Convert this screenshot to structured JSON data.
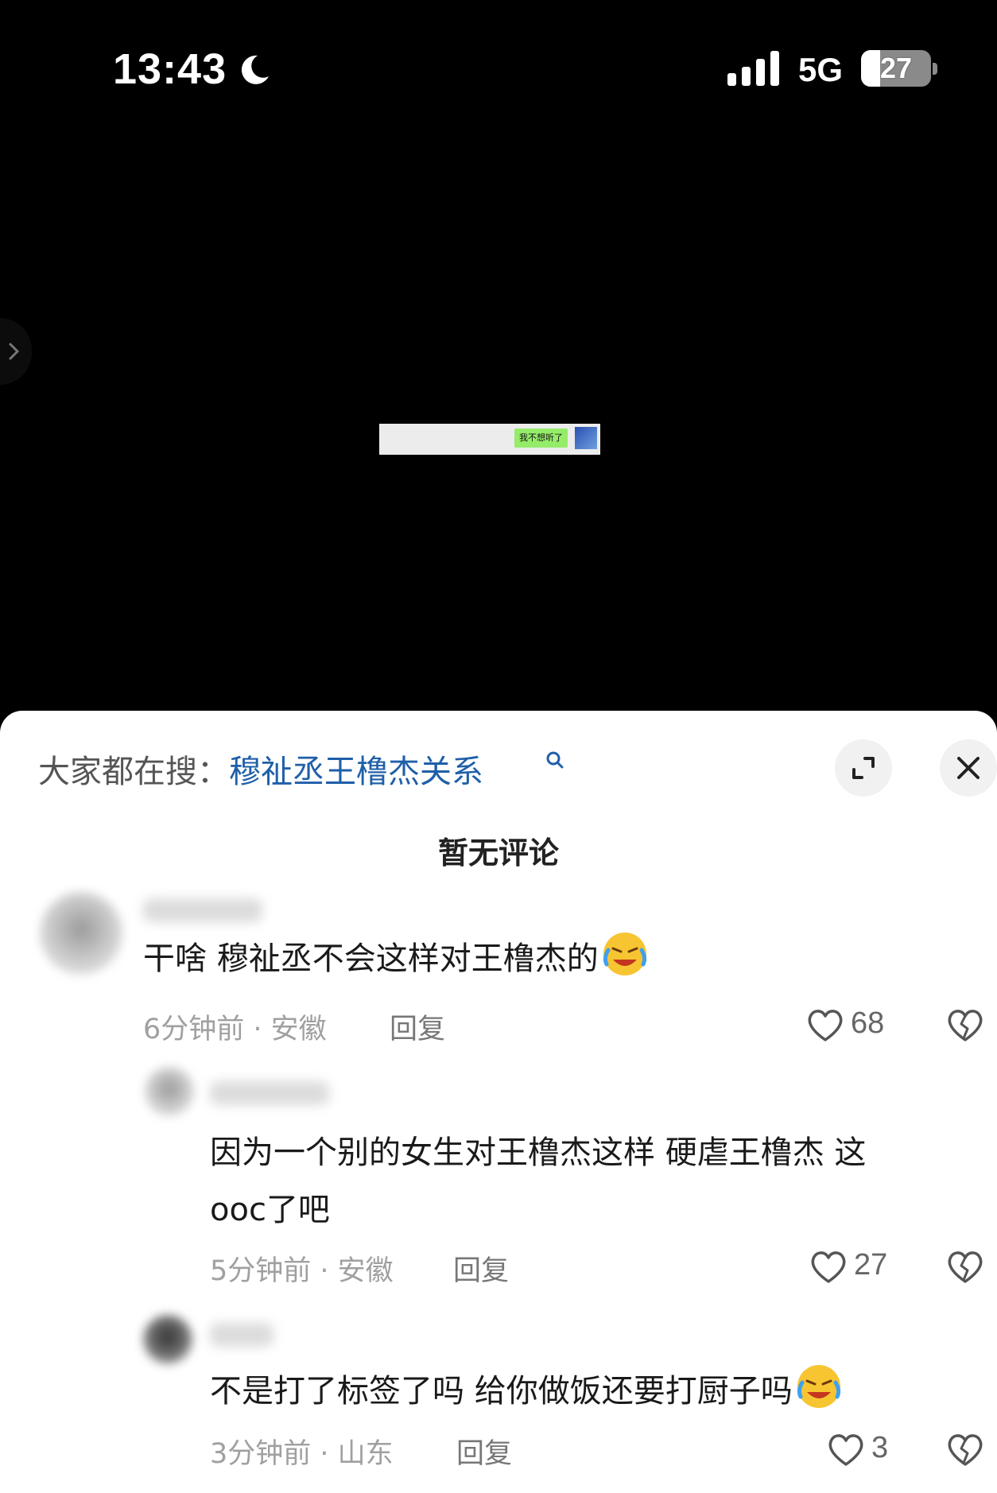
{
  "status_bar": {
    "time": "13:43",
    "network": "5G",
    "battery_level": "27",
    "battery_fraction": 0.27
  },
  "video": {
    "chat_bubble_text": "我不想听了"
  },
  "sheet": {
    "search_prefix": "大家都在搜：",
    "search_term": "穆祉丞王橹杰关系",
    "title": "暂无评论"
  },
  "comments": [
    {
      "text": "干啥 穆祉丞不会这样对王橹杰的",
      "meta": "6分钟前 · 安徽",
      "reply_label": "回复",
      "likes": "68"
    },
    {
      "text_line1": "因为一个别的女生对王橹杰这样 硬虐王橹杰 这",
      "text_line2": "ooc了吧",
      "meta": "5分钟前 · 安徽",
      "reply_label": "回复",
      "likes": "27"
    },
    {
      "text": "不是打了标签了吗 给你做饭还要打厨子吗",
      "meta": "3分钟前 · 山东",
      "reply_label": "回复",
      "likes": "3"
    }
  ],
  "icons": {
    "moon": "moon-icon",
    "signal": "cellular-signal-icon",
    "battery": "battery-icon",
    "expand": "expand-icon",
    "close": "close-icon",
    "like": "heart-icon",
    "dislike": "broken-heart-icon",
    "emoji": "laughing-crying-emoji-icon"
  },
  "colors": {
    "search_link": "#1f5fa8",
    "chat_bubble": "#95ec69",
    "sheet_background": "#ffffff"
  }
}
